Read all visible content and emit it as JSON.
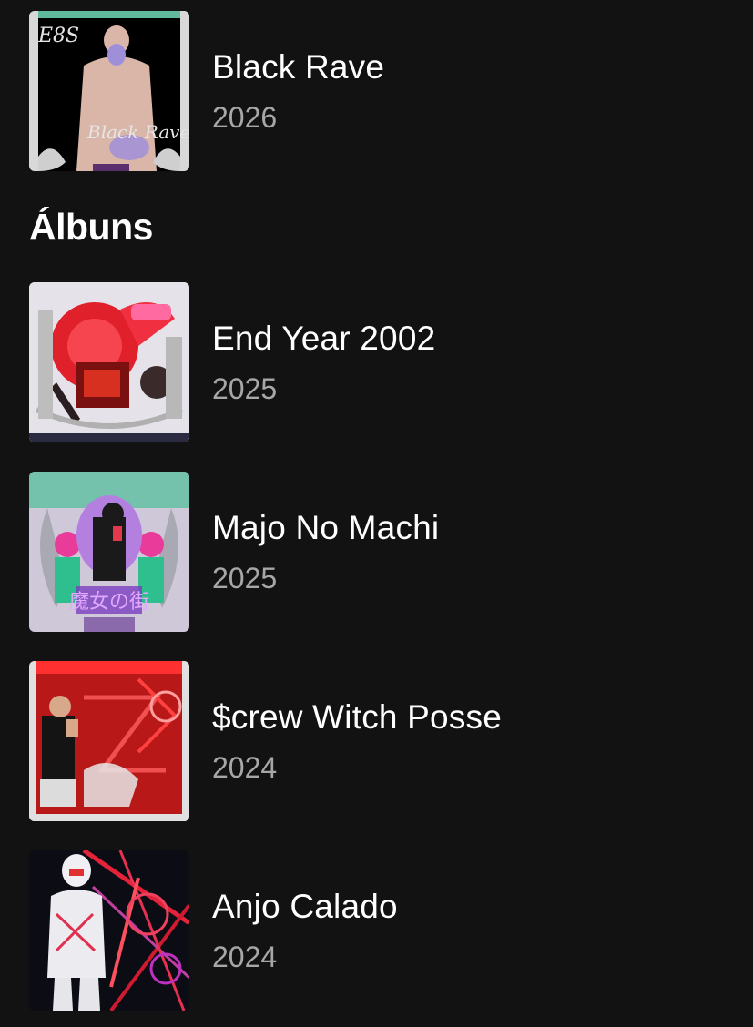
{
  "singles": [
    {
      "title": "Black Rave",
      "year": "2026"
    }
  ],
  "albums_section": {
    "title": "Álbuns"
  },
  "albums": [
    {
      "title": "End Year 2002",
      "year": "2025"
    },
    {
      "title": "Majo No Machi",
      "year": "2025"
    },
    {
      "title": "$crew Witch Posse",
      "year": "2024"
    },
    {
      "title": "Anjo Calado",
      "year": "2024"
    }
  ],
  "colors": {
    "background": "#121212",
    "primary_text": "#ffffff",
    "secondary_text": "#a7a7a7"
  }
}
